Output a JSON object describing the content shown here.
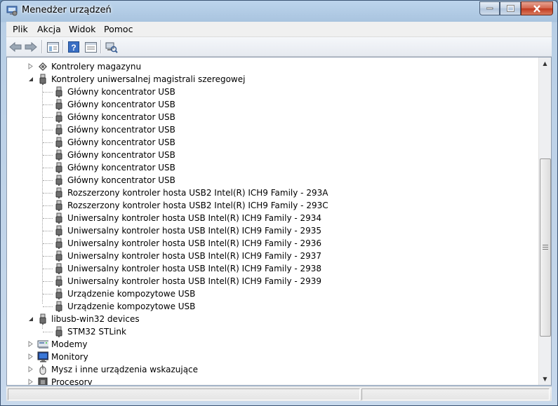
{
  "window": {
    "title": "Menedżer urządzeń"
  },
  "menu": [
    "Plik",
    "Akcja",
    "Widok",
    "Pomoc"
  ],
  "toolbar": [
    {
      "icon": "back-arrow-icon"
    },
    {
      "icon": "forward-arrow-icon"
    },
    {
      "icon": "properties-view-icon"
    },
    {
      "icon": "help-icon"
    },
    {
      "icon": "properties-icon"
    },
    {
      "icon": "scan-hardware-icon"
    }
  ],
  "tree": {
    "storage_controllers": {
      "label": "Kontrolery magazynu",
      "expanded": false
    },
    "usb_controllers": {
      "label": "Kontrolery uniwersalnej magistrali szeregowej",
      "expanded": true,
      "children": [
        "Główny koncentrator USB",
        "Główny koncentrator USB",
        "Główny koncentrator USB",
        "Główny koncentrator USB",
        "Główny koncentrator USB",
        "Główny koncentrator USB",
        "Główny koncentrator USB",
        "Główny koncentrator USB",
        "Rozszerzony kontroler hosta USB2 Intel(R) ICH9 Family - 293A",
        "Rozszerzony kontroler hosta USB2 Intel(R) ICH9 Family - 293C",
        "Uniwersalny kontroler hosta USB Intel(R) ICH9 Family - 2934",
        "Uniwersalny kontroler hosta USB Intel(R) ICH9 Family - 2935",
        "Uniwersalny kontroler hosta USB Intel(R) ICH9 Family - 2936",
        "Uniwersalny kontroler hosta USB Intel(R) ICH9 Family - 2937",
        "Uniwersalny kontroler hosta USB Intel(R) ICH9 Family - 2938",
        "Uniwersalny kontroler hosta USB Intel(R) ICH9 Family - 2939",
        "Urządzenie kompozytowe USB",
        "Urządzenie kompozytowe USB"
      ]
    },
    "libusb": {
      "label": "libusb-win32 devices",
      "expanded": true,
      "children": [
        "STM32 STLink"
      ]
    },
    "modems": {
      "label": "Modemy",
      "expanded": false
    },
    "monitors": {
      "label": "Monitory",
      "expanded": false
    },
    "mice": {
      "label": "Mysz i inne urządzenia wskazujące",
      "expanded": false
    },
    "processors": {
      "label": "Procesory",
      "expanded": false
    }
  },
  "colors": {
    "titlebar": "#a9c4df",
    "close_button": "#c1391f",
    "selection": "#3399ff"
  }
}
